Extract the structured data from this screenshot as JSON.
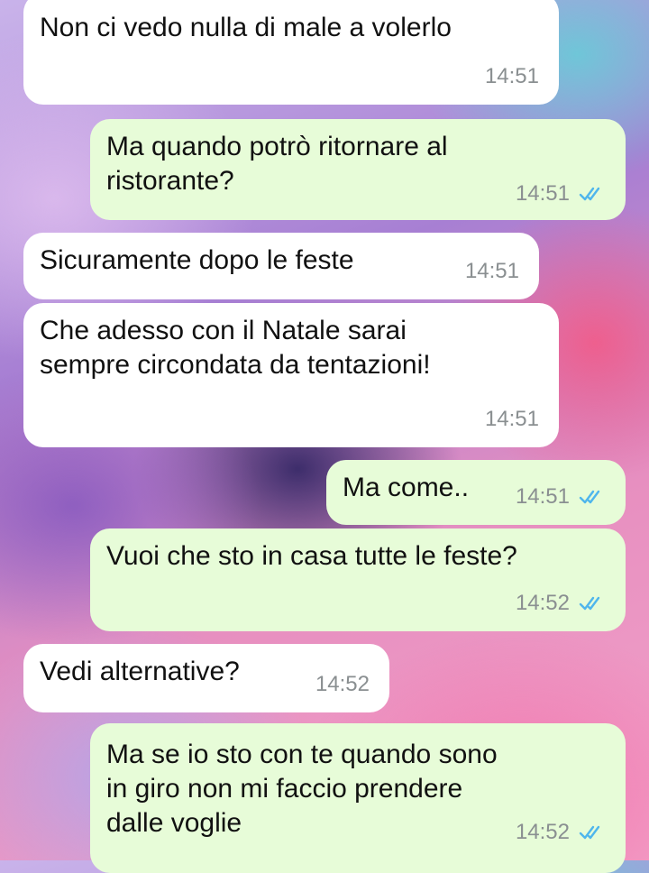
{
  "messages": [
    {
      "direction": "incoming",
      "text": "Non ci vedo nulla di male a volerlo",
      "time": "14:51"
    },
    {
      "direction": "outgoing",
      "text": "Ma quando potrò ritornare al\nristorante?",
      "time": "14:51",
      "status": "read",
      "status_icon": "double-check-icon"
    },
    {
      "direction": "incoming",
      "text": "Sicuramente dopo le feste",
      "time": "14:51"
    },
    {
      "direction": "incoming",
      "text": "Che adesso con il Natale sarai\nsempre circondata da tentazioni!",
      "time": "14:51"
    },
    {
      "direction": "outgoing",
      "text": "Ma come..",
      "time": "14:51",
      "status": "read",
      "status_icon": "double-check-icon"
    },
    {
      "direction": "outgoing",
      "text": "Vuoi che sto in casa tutte le feste?",
      "time": "14:52",
      "status": "read",
      "status_icon": "double-check-icon"
    },
    {
      "direction": "incoming",
      "text": "Vedi alternative?",
      "time": "14:52"
    },
    {
      "direction": "outgoing",
      "text": "Ma se io sto con te quando sono\nin giro non mi faccio prendere\ndalle voglie",
      "time": "14:52",
      "status": "read",
      "status_icon": "double-check-icon"
    }
  ],
  "colors": {
    "incoming_bubble": "#ffffff",
    "outgoing_bubble": "#e7fcd8",
    "read_ticks": "#4fb6ec",
    "timestamp": "#8a8f91"
  }
}
